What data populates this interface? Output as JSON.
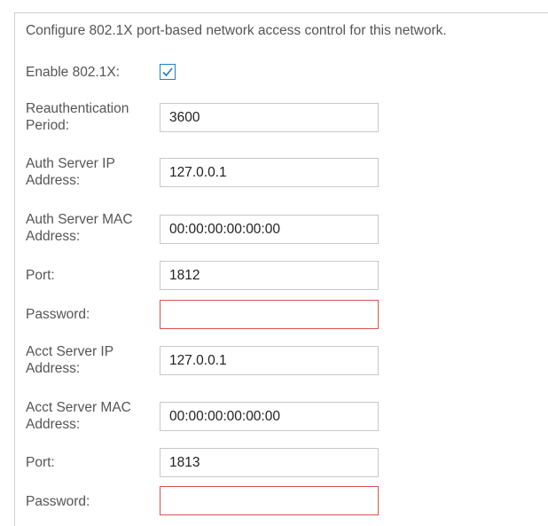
{
  "intro": "Configure 802.1X port-based network access control for this network.",
  "enable": {
    "label": "Enable 802.1X:",
    "checked": true
  },
  "reauth": {
    "label": "Reauthentication Period:",
    "value": "3600"
  },
  "auth_ip": {
    "label": "Auth Server IP Address:",
    "value": "127.0.0.1"
  },
  "auth_mac": {
    "label": "Auth Server MAC Address:",
    "value": "00:00:00:00:00:00"
  },
  "auth_port": {
    "label": "Port:",
    "value": "1812"
  },
  "auth_password": {
    "label": "Password:",
    "value": ""
  },
  "acct_ip": {
    "label": "Acct Server IP Address:",
    "value": "127.0.0.1"
  },
  "acct_mac": {
    "label": "Acct Server MAC Address:",
    "value": "00:00:00:00:00:00"
  },
  "acct_port": {
    "label": "Port:",
    "value": "1813"
  },
  "acct_password": {
    "label": "Password:",
    "value": ""
  },
  "colors": {
    "checkbox": "#1e7fc2",
    "invalid_border": "#d9534f",
    "field_border": "#c8c8c8"
  }
}
